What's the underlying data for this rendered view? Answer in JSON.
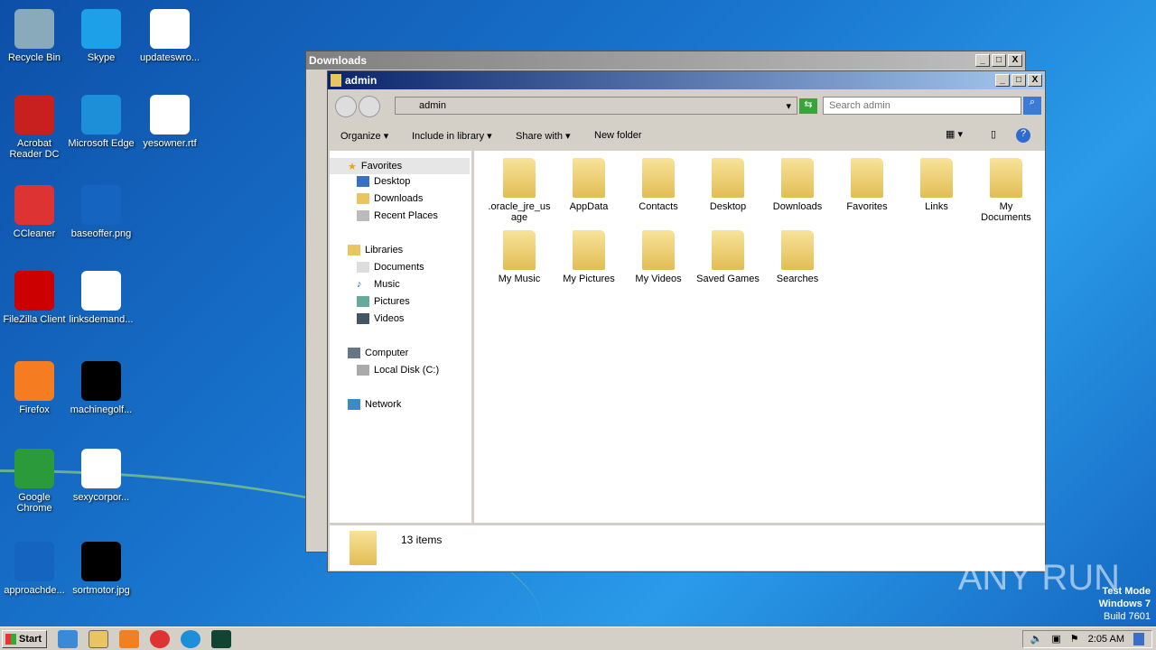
{
  "desktop": {
    "icons": [
      {
        "label": "Recycle Bin",
        "color": "#8ab"
      },
      {
        "label": "Skype",
        "color": "#1ea0e8"
      },
      {
        "label": "updateswro...",
        "color": "#fff"
      },
      {
        "label": "Acrobat Reader DC",
        "color": "#c8201e"
      },
      {
        "label": "Microsoft Edge",
        "color": "#1c8fd8"
      },
      {
        "label": "yesowner.rtf",
        "color": "#fff"
      },
      {
        "label": "CCleaner",
        "color": "#d33"
      },
      {
        "label": "baseoffer.png",
        "color": "#1565c0"
      },
      {
        "label": "FileZilla Client",
        "color": "#c00"
      },
      {
        "label": "linksdemand...",
        "color": "#fff"
      },
      {
        "label": "Firefox",
        "color": "#f57c20"
      },
      {
        "label": "machinegolf...",
        "color": "#000"
      },
      {
        "label": "Google Chrome",
        "color": "#2a9a3a"
      },
      {
        "label": "sexycorpor...",
        "color": "#fff"
      },
      {
        "label": "approachde...",
        "color": "#1565c0"
      },
      {
        "label": "sortmotor.jpg",
        "color": "#000"
      }
    ]
  },
  "back_window": {
    "title": "Downloads"
  },
  "window": {
    "title": "admin",
    "breadcrumb": "admin",
    "search_placeholder": "Search admin",
    "toolbar": {
      "organize": "Organize",
      "include": "Include in library",
      "share": "Share with",
      "new_folder": "New folder"
    },
    "nav": {
      "favorites": "Favorites",
      "desktop": "Desktop",
      "downloads": "Downloads",
      "recent": "Recent Places",
      "libraries": "Libraries",
      "documents": "Documents",
      "music": "Music",
      "pictures": "Pictures",
      "videos": "Videos",
      "computer": "Computer",
      "local_disk": "Local Disk (C:)",
      "network": "Network"
    },
    "items": [
      ".oracle_jre_usage",
      "AppData",
      "Contacts",
      "Desktop",
      "Downloads",
      "Favorites",
      "Links",
      "My Documents",
      "My Music",
      "My Pictures",
      "My Videos",
      "Saved Games",
      "Searches"
    ],
    "status": "13 items"
  },
  "taskbar": {
    "start": "Start",
    "clock": "2:05 AM"
  },
  "watermark": {
    "brand": "ANY RUN",
    "line1": "Test Mode",
    "line2": "Windows 7",
    "line3": "Build 7601"
  }
}
